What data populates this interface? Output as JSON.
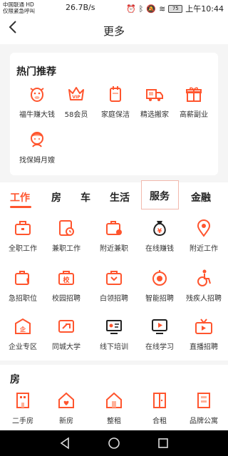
{
  "status": {
    "carrier1": "中国联通 HD",
    "carrier2": "仅限紧急呼叫",
    "speed": "26.7B/s",
    "battery": "75",
    "time": "上午10:44"
  },
  "nav": {
    "back_icon": "chevron-left-icon",
    "title": "更多"
  },
  "hot": {
    "title": "热门推荐",
    "items": [
      {
        "label": "福牛赚大钱",
        "icon": "bull-icon"
      },
      {
        "label": "58会员",
        "icon": "vip-icon"
      },
      {
        "label": "家庭保洁",
        "icon": "cleaning-icon"
      },
      {
        "label": "精选搬家",
        "icon": "moving-truck-icon"
      },
      {
        "label": "高薪副业",
        "icon": "gift-icon"
      },
      {
        "label": "找保姆月嫂",
        "icon": "nanny-icon"
      }
    ]
  },
  "tabs": [
    {
      "label": "工作",
      "active": true
    },
    {
      "label": "房",
      "active": false
    },
    {
      "label": "车",
      "active": false
    },
    {
      "label": "生活",
      "active": false
    },
    {
      "label": "服务",
      "active": false
    },
    {
      "label": "金融",
      "active": false
    }
  ],
  "work": {
    "items": [
      {
        "label": "全职工作",
        "icon": "briefcase-icon"
      },
      {
        "label": "兼职工作",
        "icon": "clock-doc-icon"
      },
      {
        "label": "附近兼职",
        "icon": "nearby-job-icon"
      },
      {
        "label": "在线赚钱",
        "icon": "money-bag-icon"
      },
      {
        "label": "附近工作",
        "icon": "location-pin-icon"
      },
      {
        "label": "急招职位",
        "icon": "urgent-job-icon"
      },
      {
        "label": "校园招聘",
        "icon": "campus-icon"
      },
      {
        "label": "白领招聘",
        "icon": "whitecollar-icon"
      },
      {
        "label": "智能招聘",
        "icon": "smart-icon"
      },
      {
        "label": "残疾人招聘",
        "icon": "wheelchair-icon"
      },
      {
        "label": "企业专区",
        "icon": "enterprise-icon"
      },
      {
        "label": "同城大学",
        "icon": "university-icon"
      },
      {
        "label": "线下培训",
        "icon": "training-icon"
      },
      {
        "label": "在线学习",
        "icon": "play-screen-icon"
      },
      {
        "label": "直播招聘",
        "icon": "tv-icon"
      }
    ]
  },
  "house": {
    "title": "房",
    "items": [
      {
        "label": "二手房",
        "icon": "building-icon"
      },
      {
        "label": "新房",
        "icon": "house-heart-icon"
      },
      {
        "label": "整租",
        "icon": "house-icon"
      },
      {
        "label": "合租",
        "icon": "door-icon"
      },
      {
        "label": "品牌公寓",
        "icon": "apartment-icon"
      }
    ]
  },
  "sysnav": {
    "back": "back-triangle-icon",
    "home": "home-circle-icon",
    "recent": "recent-square-icon"
  },
  "colors": {
    "accent": "#ff552e",
    "tab_active": "#ff552e"
  }
}
